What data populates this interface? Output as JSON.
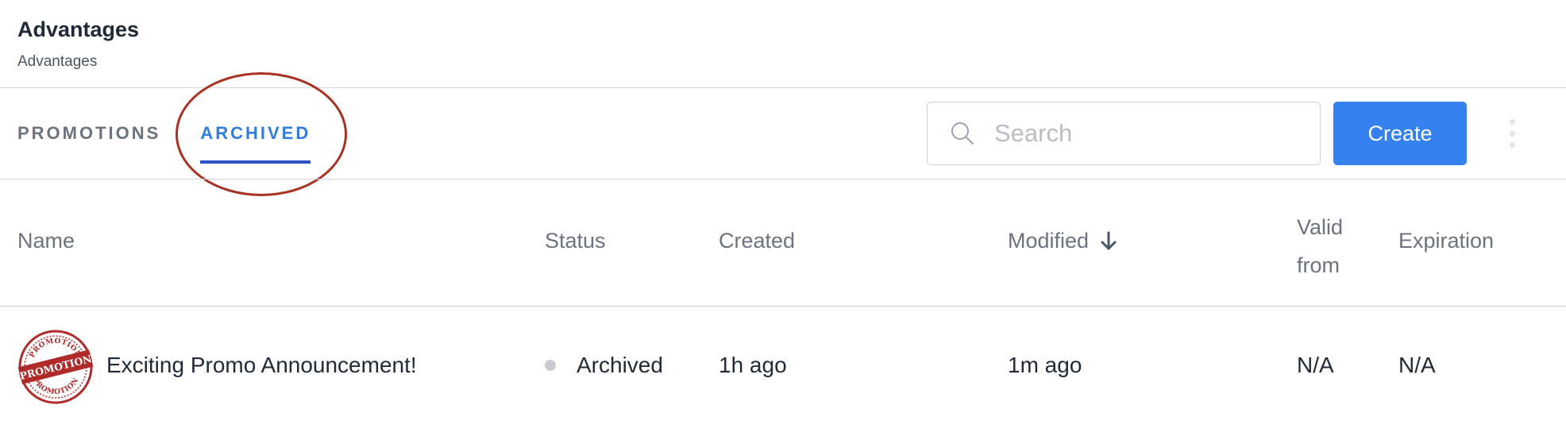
{
  "header": {
    "title": "Advantages",
    "breadcrumb": "Advantages"
  },
  "tabs": [
    {
      "label": "PROMOTIONS",
      "active": false
    },
    {
      "label": "ARCHIVED",
      "active": true
    }
  ],
  "search": {
    "placeholder": "Search",
    "value": ""
  },
  "toolbar": {
    "create_label": "Create",
    "more_icon": "more-vertical-icon"
  },
  "table": {
    "columns": {
      "name": "Name",
      "status": "Status",
      "created": "Created",
      "modified": "Modified",
      "valid_from": "Valid from",
      "expiration": "Expiration"
    },
    "sort": {
      "column": "modified",
      "direction": "descending",
      "icon": "arrow-down-icon"
    },
    "rows": [
      {
        "name": "Exciting Promo Announcement!",
        "logo_text": "PROMOTION",
        "status": "Archived",
        "created": "1h ago",
        "modified": "1m ago",
        "valid_from": "N/A",
        "expiration": "N/A"
      }
    ]
  },
  "colors": {
    "accent": "#3481ef",
    "active_tab": "#2f7de1",
    "tab_underline": "#2f4fc7",
    "annotation": "#a83224",
    "logo": "#b02a2a",
    "status_archived": "#c8cbd0"
  }
}
